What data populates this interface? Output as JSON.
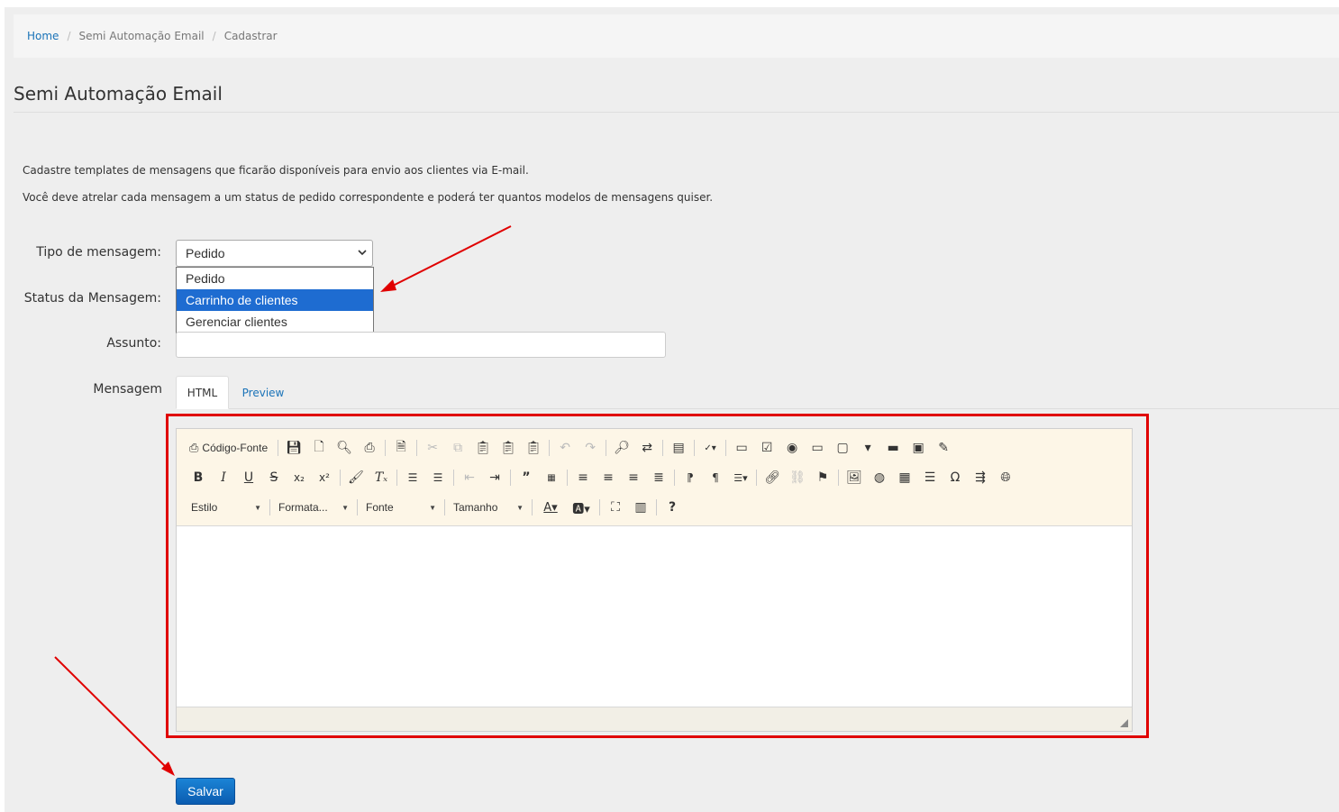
{
  "breadcrumb": {
    "home": "Home",
    "section": "Semi Automação Email",
    "current": "Cadastrar"
  },
  "page": {
    "title": "Semi Automação Email"
  },
  "intro": {
    "line1": "Cadastre templates de mensagens que ficarão disponíveis para envio aos clientes via E-mail.",
    "line2": "Você deve atrelar cada mensagem a um status de pedido correspondente e poderá ter quantos modelos de mensagens quiser."
  },
  "form": {
    "tipo_label": "Tipo de mensagem:",
    "tipo_value": "Pedido",
    "tipo_options": [
      "Pedido",
      "Carrinho de clientes",
      "Gerenciar clientes"
    ],
    "tipo_highlighted": "Carrinho de clientes",
    "status_label": "Status da Mensagem:",
    "assunto_label": "Assunto:",
    "assunto_value": "",
    "mensagem_label": "Mensagem"
  },
  "tabs": {
    "html": "HTML",
    "preview": "Preview"
  },
  "editor": {
    "source_label": "Código-Fonte",
    "combos": {
      "style": "Estilo",
      "format": "Formata...",
      "font": "Fonte",
      "size": "Tamanho"
    }
  },
  "actions": {
    "save": "Salvar"
  },
  "colors": {
    "accent": "#1a73b8",
    "highlight_frame": "#e00000",
    "annotation_arrow": "#e00000",
    "selected_option": "#1e6cd1"
  }
}
